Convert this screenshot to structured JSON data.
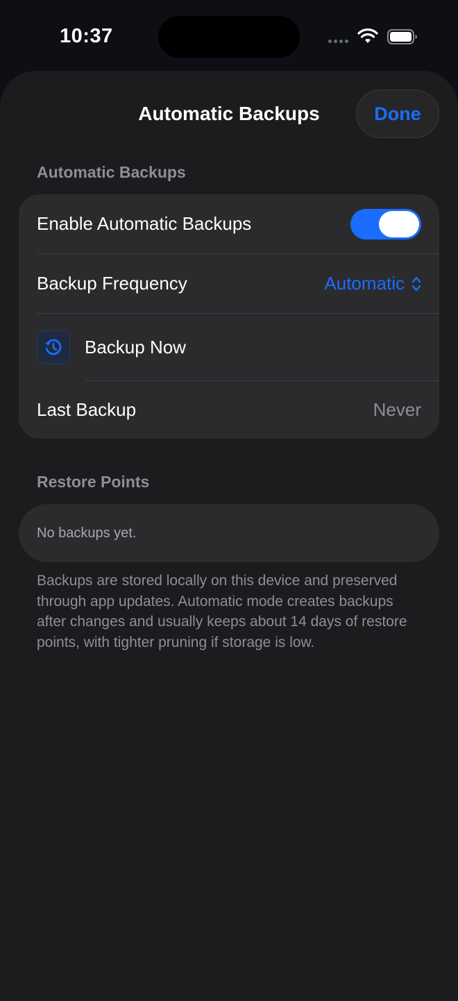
{
  "status_bar": {
    "time": "10:37"
  },
  "sheet": {
    "title": "Automatic Backups",
    "done_label": "Done"
  },
  "automatic_section": {
    "header": "Automatic Backups",
    "enable_label": "Enable Automatic Backups",
    "enable_on": true,
    "frequency_label": "Backup Frequency",
    "frequency_value": "Automatic",
    "backup_now_label": "Backup Now",
    "last_backup_label": "Last Backup",
    "last_backup_value": "Never"
  },
  "restore_section": {
    "header": "Restore Points",
    "empty_text": "No backups yet."
  },
  "footer_note": "Backups are stored locally on this device and preserved through app updates. Automatic mode creates backups after changes and usually keeps about 14 days of restore points, with tighter pruning if storage is low.",
  "colors": {
    "accent": "#1a6dff",
    "background": "#1c1c1e",
    "card": "#2b2b2e",
    "secondary_text": "#8e8f95"
  }
}
